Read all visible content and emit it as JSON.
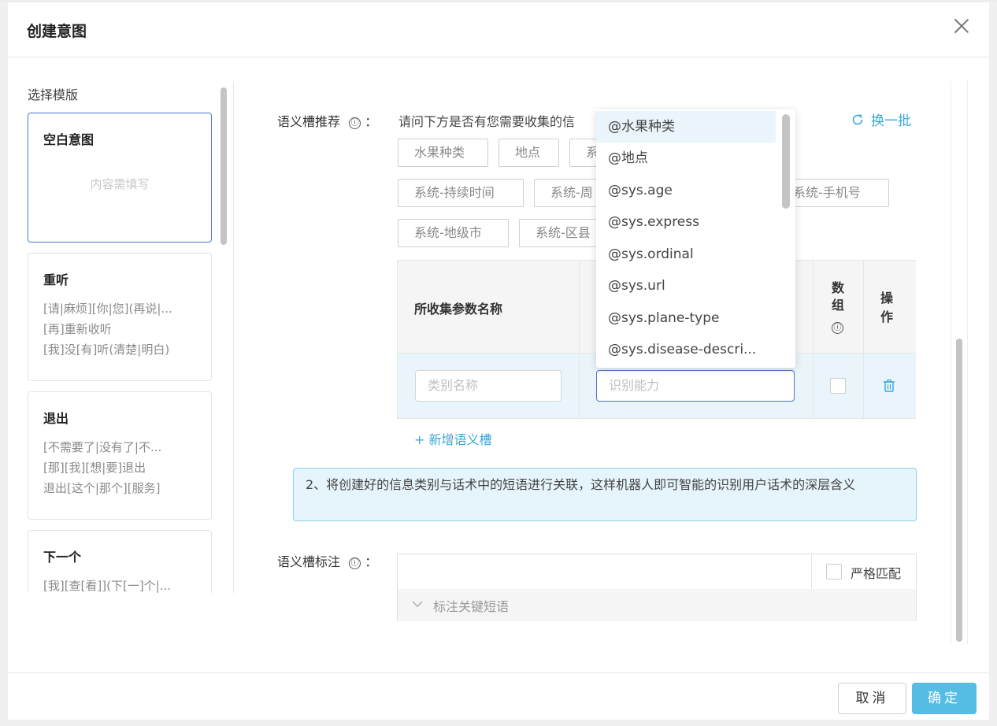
{
  "dialog": {
    "title": "创建意图"
  },
  "template_panel": {
    "title": "选择模版",
    "cards": [
      {
        "name": "空白意图",
        "placeholder": "内容需填写"
      },
      {
        "name": "重听",
        "lines": [
          "[请|麻烦][你|您](再说|...",
          "[再]重新收听",
          "[我]没[有]听(清楚|明白)"
        ]
      },
      {
        "name": "退出",
        "lines": [
          "[不需要了|没有了|不...",
          "[那][我][想|要]退出",
          "退出[这个|那个][服务]"
        ]
      },
      {
        "name": "下一个",
        "lines": [
          "[我][查[看]](下[一]个|..."
        ]
      }
    ]
  },
  "slot_recommend": {
    "label": "语义槽推荐",
    "info_icon": "ⓘ",
    "colon": "：",
    "intro": "请问下方是否有您需要收集的信",
    "refresh_label": "换一批",
    "tags": [
      "水果种类",
      "地点",
      "系",
      "系统-持续时间",
      "系统-周",
      "系统-手机号",
      "系统-地级市",
      "系统-区县"
    ]
  },
  "param_table": {
    "headers": {
      "name": "所收集参数名称",
      "array": "数组",
      "array_info": "ⓘ",
      "action": "操作"
    },
    "row": {
      "name_placeholder": "类别名称",
      "ability_placeholder": "识别能力"
    }
  },
  "add_slot_label": "+ 新增语义槽",
  "notice": "2、将创建好的信息类别与话术中的短语进行关联，这样机器人即可智能的识别用户话术的深层含义",
  "slot_annotation": {
    "label": "语义槽标注",
    "info_icon": "ⓘ",
    "colon": "：",
    "strict_match": "严格匹配",
    "phrase_label": "标注关键短语"
  },
  "dropdown": {
    "options": [
      "@水果种类",
      "@地点",
      "@sys.age",
      "@sys.express",
      "@sys.ordinal",
      "@sys.url",
      "@sys.plane-type",
      "@sys.disease-descri..."
    ]
  },
  "footer": {
    "cancel": "取消",
    "ok": "确定"
  },
  "colors": {
    "accent": "#3aa7d6",
    "primary_button": "#55bde4",
    "focus_border": "#4a78c8",
    "notice_bg": "#e6f5fc"
  },
  "icons": {
    "close": "close-icon",
    "refresh": "refresh-icon",
    "delete": "trash-icon",
    "expand": "chevron-down-icon"
  }
}
